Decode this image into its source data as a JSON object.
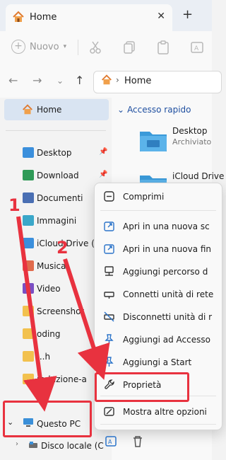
{
  "window": {
    "tab_title": "Home"
  },
  "toolbar": {
    "new_label": "Nuovo"
  },
  "address": {
    "crumb": "Home"
  },
  "sidebar": {
    "home_label": "Home",
    "items": [
      {
        "label": "Desktop",
        "color": "#3b8fdc",
        "pinned": true
      },
      {
        "label": "Download",
        "color": "#2f9a57",
        "pinned": true
      },
      {
        "label": "Documenti",
        "color": "#4a6fb3",
        "pinned": false
      },
      {
        "label": "Immagini",
        "color": "#3aa7c9",
        "pinned": false
      },
      {
        "label": "iCloud Drive (M",
        "color": "#3b8fdc",
        "pinned": false
      },
      {
        "label": "Musica",
        "color": "#e06a4c",
        "pinned": false
      },
      {
        "label": "Video",
        "color": "#7a4fc4",
        "pinned": false
      },
      {
        "label": "Screenshot",
        "color": "#f2c14e",
        "pinned": false
      },
      {
        "label": "oding",
        "color": "#f2c14e",
        "pinned": false
      },
      {
        "label": "...h",
        "color": "#f2c14e",
        "pinned": false
      },
      {
        "label": "roduzione-a",
        "color": "#f2c14e",
        "pinned": false
      }
    ],
    "this_pc_label": "Questo PC",
    "disk_label": "Disco locale (C"
  },
  "main": {
    "quick_access_label": "Accesso rapido",
    "desktop_label": "Desktop",
    "desktop_sub": "Archiviato",
    "icloud_label": "iCloud Drive"
  },
  "context_menu": {
    "items": [
      {
        "label": "Comprimi",
        "icon": "compress-icon"
      },
      {
        "label": "Apri in una nuova sc",
        "icon": "open-tab-icon"
      },
      {
        "label": "Apri in una nuova fin",
        "icon": "open-window-icon"
      },
      {
        "label": "Aggiungi percorso d",
        "icon": "network-location-icon"
      },
      {
        "label": "Connetti unità di rete",
        "icon": "map-drive-icon"
      },
      {
        "label": "Disconnetti unità di r",
        "icon": "disconnect-drive-icon"
      },
      {
        "label": "Aggiungi ad Accesso",
        "icon": "pin-icon"
      },
      {
        "label": "Aggiungi a Start",
        "icon": "pin-start-icon"
      },
      {
        "label": "Proprietà",
        "icon": "wrench-icon"
      },
      {
        "label": "Mostra altre opzioni",
        "icon": "more-options-icon"
      }
    ]
  },
  "annotations": {
    "step1": "1",
    "step2": "2",
    "color": "#e8323f"
  }
}
